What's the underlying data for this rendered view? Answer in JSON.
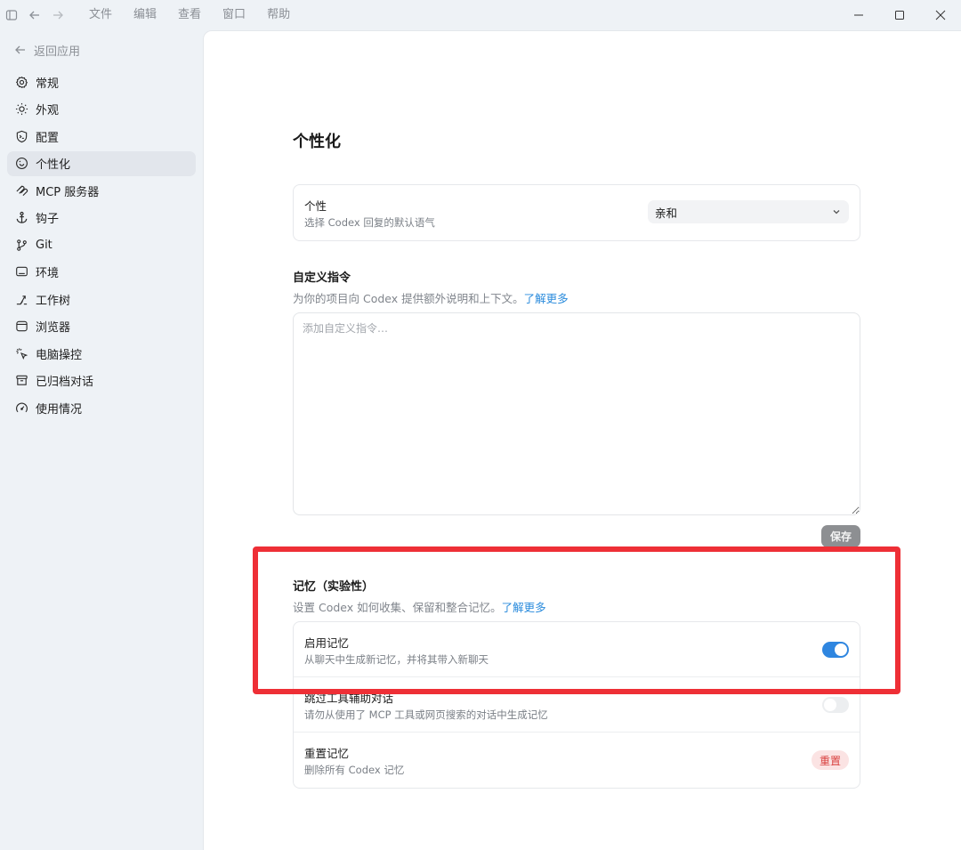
{
  "menubar": {
    "items": [
      "文件",
      "编辑",
      "查看",
      "窗口",
      "帮助"
    ]
  },
  "sidebar": {
    "back_label": "返回应用",
    "items": [
      {
        "label": "常规",
        "icon": "gear-icon",
        "active": false
      },
      {
        "label": "外观",
        "icon": "sun-icon",
        "active": false
      },
      {
        "label": "配置",
        "icon": "shield-icon",
        "active": false
      },
      {
        "label": "个性化",
        "icon": "smile-icon",
        "active": true
      },
      {
        "label": "MCP 服务器",
        "icon": "mcp-icon",
        "active": false
      },
      {
        "label": "钩子",
        "icon": "anchor-icon",
        "active": false
      },
      {
        "label": "Git",
        "icon": "git-branch-icon",
        "active": false
      },
      {
        "label": "环境",
        "icon": "monitor-icon",
        "active": false
      },
      {
        "label": "工作树",
        "icon": "worktree-icon",
        "active": false
      },
      {
        "label": "浏览器",
        "icon": "browser-icon",
        "active": false
      },
      {
        "label": "电脑操控",
        "icon": "cursor-click-icon",
        "active": false
      },
      {
        "label": "已归档对话",
        "icon": "archive-icon",
        "active": false
      },
      {
        "label": "使用情况",
        "icon": "gauge-icon",
        "active": false
      }
    ]
  },
  "main": {
    "title": "个性化",
    "personality": {
      "title": "个性",
      "desc": "选择 Codex 回复的默认语气",
      "selected": "亲和"
    },
    "custom_instructions": {
      "title": "自定义指令",
      "desc": "为你的项目向 Codex 提供额外说明和上下文。",
      "link": "了解更多",
      "placeholder": "添加自定义指令…",
      "save_label": "保存"
    },
    "memory": {
      "title": "记忆（实验性）",
      "desc": "设置 Codex 如何收集、保留和整合记忆。",
      "link": "了解更多",
      "rows": [
        {
          "title": "启用记忆",
          "desc": "从聊天中生成新记忆，并将其带入新聊天",
          "toggle": true
        },
        {
          "title": "跳过工具辅助对话",
          "desc": "请勿从使用了 MCP 工具或网页搜索的对话中生成记忆",
          "toggle": false
        },
        {
          "title": "重置记忆",
          "desc": "删除所有 Codex 记忆",
          "button": "重置"
        }
      ]
    }
  },
  "colors": {
    "accent": "#2f86e0",
    "highlight": "#ee2f36",
    "danger": "#d9403f",
    "link": "#2a8bdc"
  }
}
